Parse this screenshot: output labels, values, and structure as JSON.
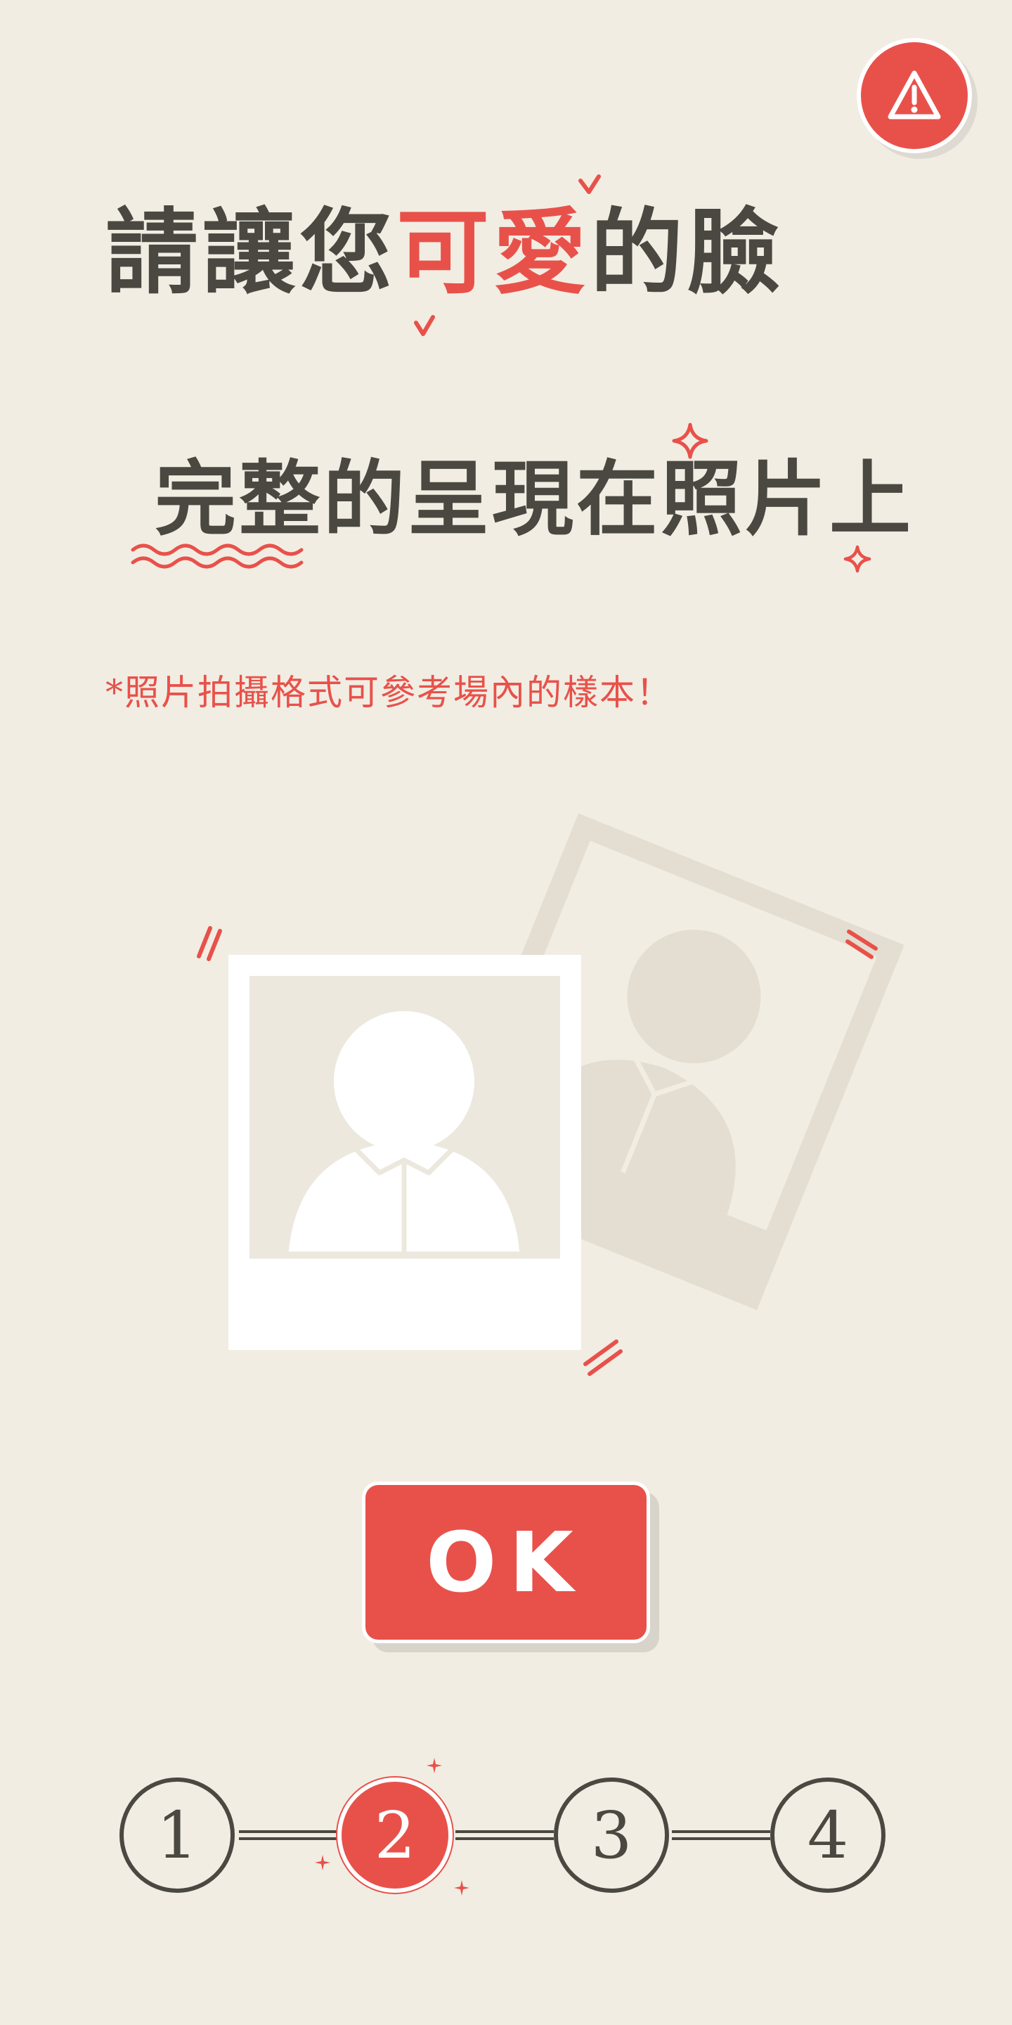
{
  "header": {
    "warning_icon": "warning-triangle-icon"
  },
  "headline": {
    "line1_before": "請讓您",
    "line1_highlight": "可愛",
    "line1_after": "的臉",
    "line2": "完整的呈現在照片上"
  },
  "note": "*照片拍攝格式可參考場內的樣本！",
  "illustration": {
    "front_icon": "person-silhouette-icon",
    "back_icon": "person-silhouette-icon"
  },
  "ok_button": {
    "label": "OK"
  },
  "steps": {
    "items": [
      "1",
      "2",
      "3",
      "4"
    ],
    "active_index": 1
  },
  "colors": {
    "background": "#f1ede3",
    "accent": "#e8514a",
    "text": "#4a4840",
    "photo_back": "#e3ded1"
  }
}
